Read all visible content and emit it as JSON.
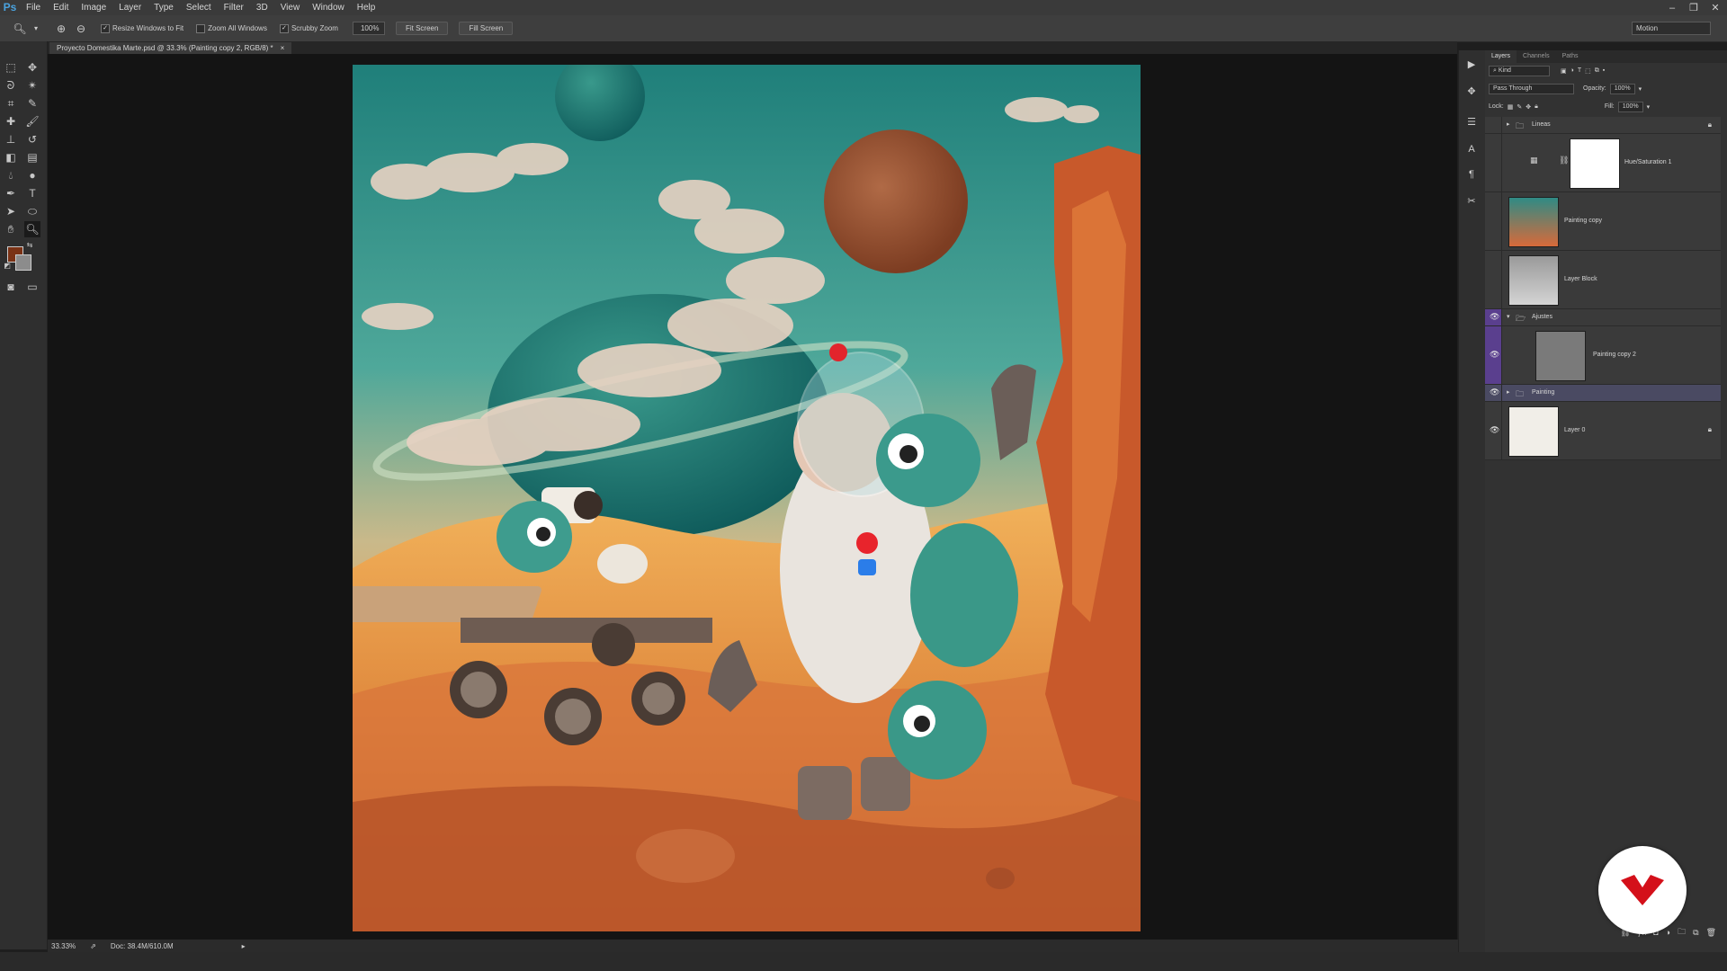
{
  "app": {
    "logo": "Ps"
  },
  "menu": [
    "File",
    "Edit",
    "Image",
    "Layer",
    "Type",
    "Select",
    "Filter",
    "3D",
    "View",
    "Window",
    "Help"
  ],
  "window_controls": [
    "–",
    "❐",
    "✕"
  ],
  "options": {
    "resize_windows": "Resize Windows to Fit",
    "zoom_all": "Zoom All Windows",
    "scrubby_zoom": "Scrubby Zoom",
    "zoom_value": "100%",
    "fit_screen": "Fit Screen",
    "fill_screen": "Fill Screen",
    "workspace": "Motion"
  },
  "document": {
    "tab_title": "Proyecto Domestika Marte.psd @ 33.3% (Painting copy 2, RGB/8) *",
    "tab_close": "×"
  },
  "status": {
    "zoom": "33.33%",
    "doc": "Doc: 38.4M/610.0M"
  },
  "panels": {
    "tabs": [
      "Layers",
      "Channels",
      "Paths"
    ],
    "kind": "Kind",
    "blend_mode": "Pass Through",
    "opacity_label": "Opacity:",
    "opacity_value": "100%",
    "lock_label": "Lock:",
    "fill_label": "Fill:",
    "fill_value": "100%"
  },
  "layers": [
    {
      "name": "Lineas",
      "type": "group"
    },
    {
      "name": "Hue/Saturation 1",
      "type": "adjustment"
    },
    {
      "name": "Painting copy",
      "type": "layer"
    },
    {
      "name": "Layer Block",
      "type": "layer"
    },
    {
      "name": "Ajustes",
      "type": "group"
    },
    {
      "name": "Painting copy 2",
      "type": "layer"
    },
    {
      "name": "Painting",
      "type": "group"
    },
    {
      "name": "Layer 0",
      "type": "layer"
    }
  ],
  "colors": {
    "foreground": "#7a3215",
    "background": "#8c8c8c",
    "eye_active": "#5a3f8e",
    "accent_badge": "#d4101a"
  }
}
